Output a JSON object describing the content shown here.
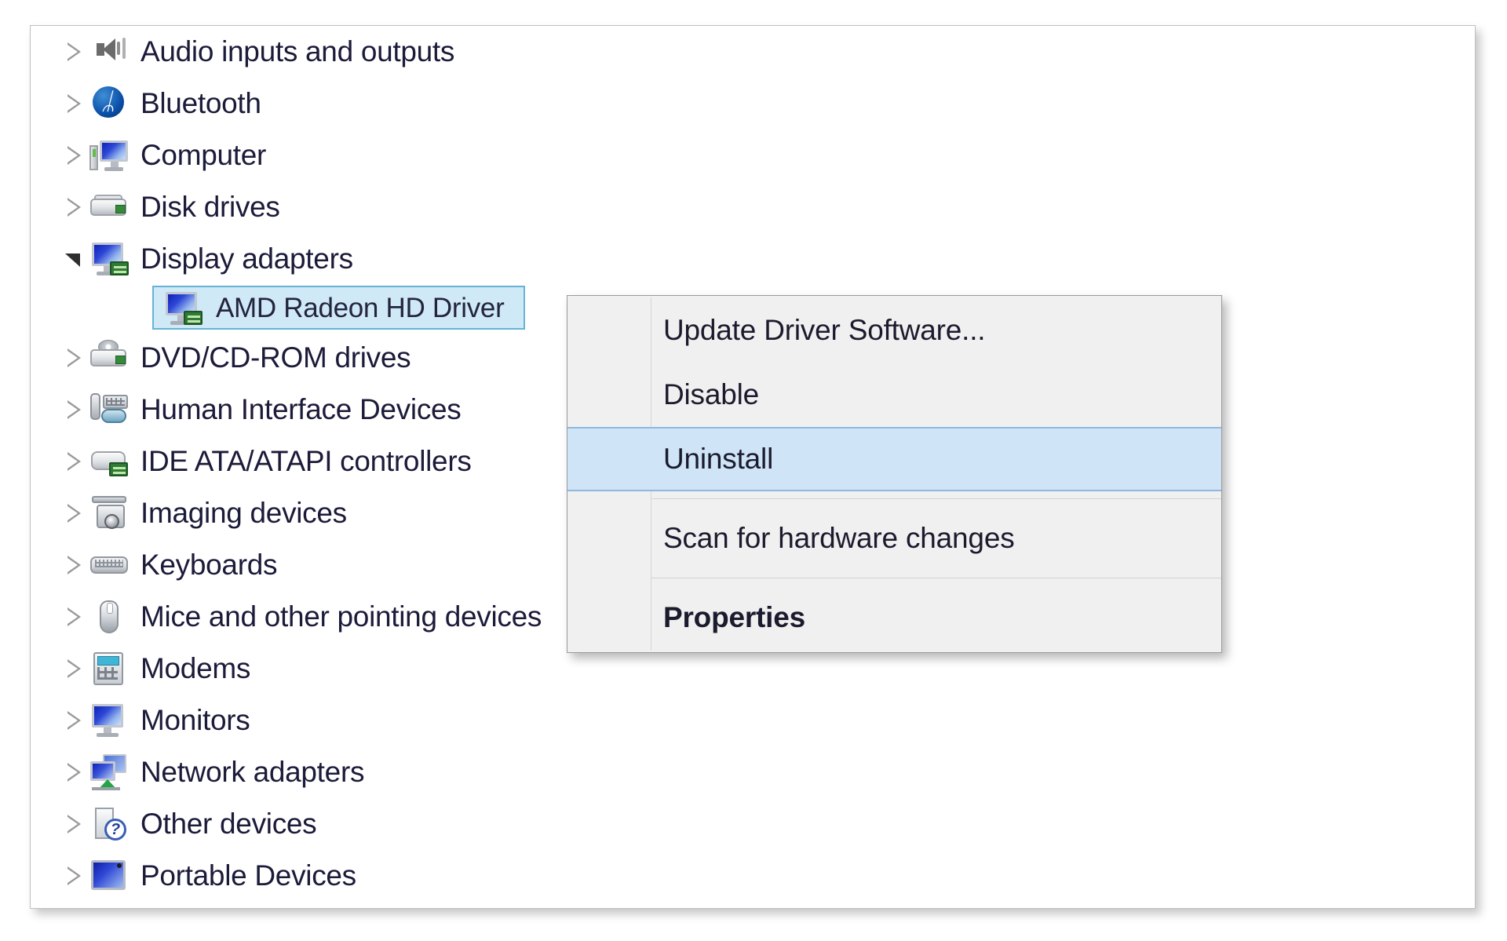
{
  "window": {
    "name": "Device Manager device tree"
  },
  "tree": {
    "items": [
      {
        "label": "Audio inputs and outputs",
        "icon": "speaker-icon",
        "expanded": false,
        "level": 0
      },
      {
        "label": "Bluetooth",
        "icon": "bluetooth-icon",
        "expanded": false,
        "level": 0
      },
      {
        "label": "Computer",
        "icon": "computer-icon",
        "expanded": false,
        "level": 0
      },
      {
        "label": "Disk drives",
        "icon": "disk-drive-icon",
        "expanded": false,
        "level": 0
      },
      {
        "label": "Display adapters",
        "icon": "display-adapter-icon",
        "expanded": true,
        "level": 0
      },
      {
        "label": "DVD/CD-ROM drives",
        "icon": "dvd-drive-icon",
        "expanded": false,
        "level": 0
      },
      {
        "label": "Human Interface Devices",
        "icon": "hid-icon",
        "expanded": false,
        "level": 0
      },
      {
        "label": "IDE ATA/ATAPI controllers",
        "icon": "ide-controller-icon",
        "expanded": false,
        "level": 0
      },
      {
        "label": "Imaging devices",
        "icon": "imaging-device-icon",
        "expanded": false,
        "level": 0
      },
      {
        "label": "Keyboards",
        "icon": "keyboard-icon",
        "expanded": false,
        "level": 0
      },
      {
        "label": "Mice and other pointing devices",
        "icon": "mouse-icon",
        "expanded": false,
        "level": 0
      },
      {
        "label": "Modems",
        "icon": "modem-icon",
        "expanded": false,
        "level": 0
      },
      {
        "label": "Monitors",
        "icon": "monitor-icon",
        "expanded": false,
        "level": 0
      },
      {
        "label": "Network adapters",
        "icon": "network-adapter-icon",
        "expanded": false,
        "level": 0
      },
      {
        "label": "Other devices",
        "icon": "unknown-device-icon",
        "expanded": false,
        "level": 0
      },
      {
        "label": "Portable Devices",
        "icon": "portable-device-icon",
        "expanded": false,
        "level": 0
      }
    ],
    "selected_child": {
      "label": "AMD Radeon HD Driver",
      "icon": "display-adapter-icon",
      "parent": "Display adapters",
      "selected": true
    }
  },
  "context_menu": {
    "entries": [
      {
        "type": "item",
        "label": "Update Driver Software...",
        "highlighted": false,
        "bold": false
      },
      {
        "type": "item",
        "label": "Disable",
        "highlighted": false,
        "bold": false
      },
      {
        "type": "item",
        "label": "Uninstall",
        "highlighted": true,
        "bold": false
      },
      {
        "type": "separator",
        "label": ""
      },
      {
        "type": "item",
        "label": "Scan for hardware changes",
        "highlighted": false,
        "bold": false
      },
      {
        "type": "separator",
        "label": ""
      },
      {
        "type": "item",
        "label": "Properties",
        "highlighted": false,
        "bold": true
      }
    ]
  },
  "colors": {
    "panel_background": "#ffffff",
    "tree_text": "#1b1b3a",
    "selection_fill": "#cfe9f6",
    "selection_border": "#66b3d6",
    "menu_background": "#f0f0f0",
    "menu_border": "#9a9a9a",
    "menu_highlight_fill": "#cfe4f7",
    "menu_highlight_border": "#8fb8dd",
    "menu_separator": "#d2d2d2"
  }
}
